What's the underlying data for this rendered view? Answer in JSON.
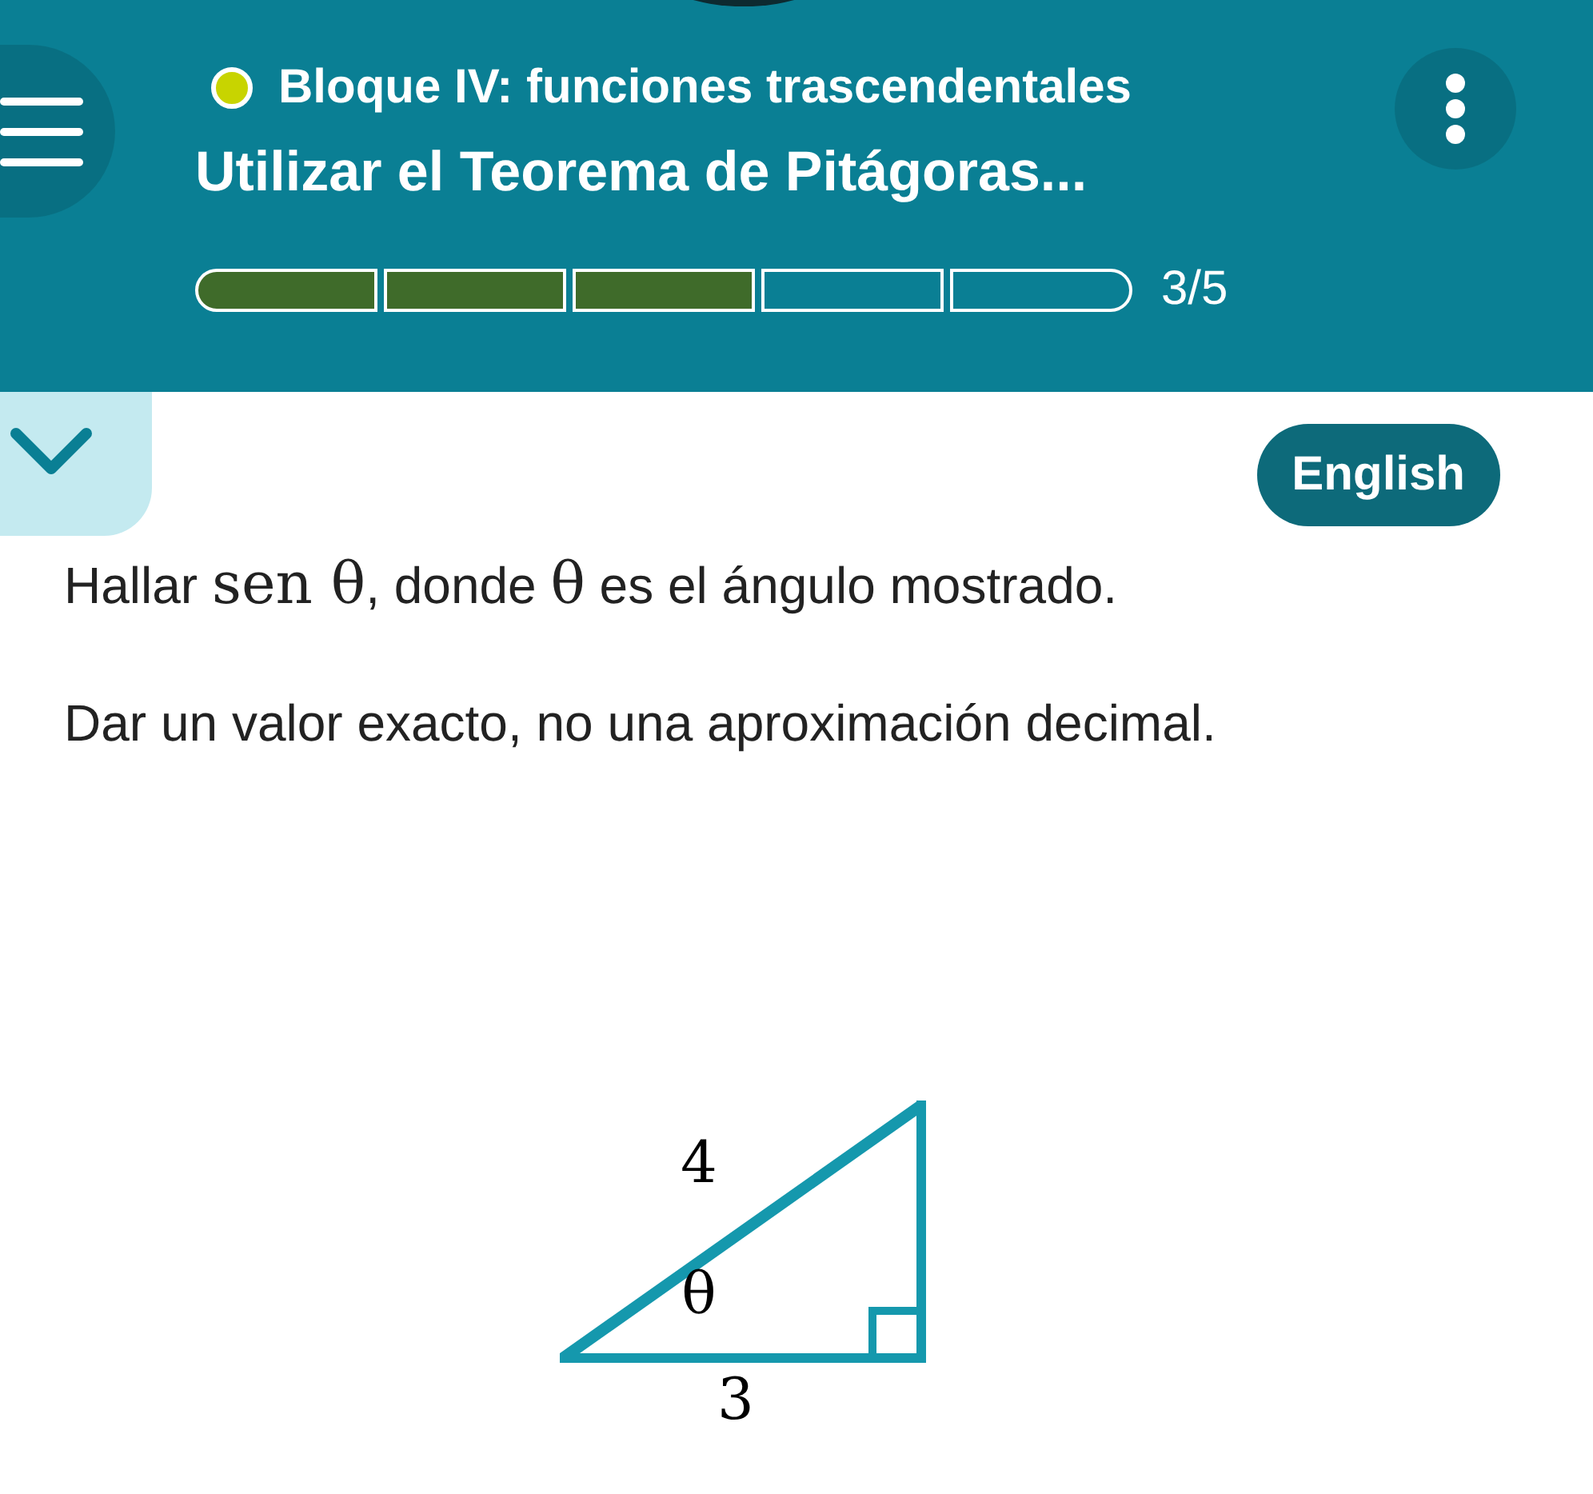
{
  "header": {
    "block": "Bloque IV: funciones trascendentales",
    "lesson": "Utilizar el Teorema de Pitágoras...",
    "progress": [
      {
        "filled": true
      },
      {
        "filled": true
      },
      {
        "filled": true
      },
      {
        "filled": false
      },
      {
        "filled": false
      }
    ],
    "progress_text": "3/5"
  },
  "language_button": "English",
  "prompt": [
    {
      "kind": "text",
      "text": "Hallar "
    },
    {
      "kind": "math",
      "text": "sen θ"
    },
    {
      "kind": "text",
      "text": ", donde "
    },
    {
      "kind": "math",
      "text": "θ"
    },
    {
      "kind": "text",
      "text": " es el ángulo mostrado."
    }
  ],
  "instruction": "Dar un valor exacto, no una aproximación decimal.",
  "triangle": {
    "hypotenuse": "4",
    "angle": "θ",
    "base": "3"
  }
}
